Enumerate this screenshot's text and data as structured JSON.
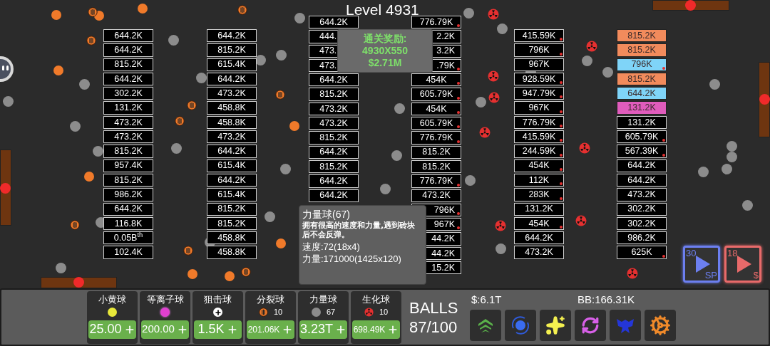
{
  "level_title": "Level 4931",
  "reward_popup": {
    "title": "通关奖励:",
    "multiplier": "4930X550",
    "money": "$2.71M"
  },
  "brick_columns": [
    {
      "bricks": [
        {
          "value": "644.2K",
          "infected": false
        },
        {
          "value": "644.2K",
          "infected": false
        },
        {
          "value": "815.2K",
          "infected": false
        },
        {
          "value": "644.2K",
          "infected": false
        },
        {
          "value": "302.2K",
          "infected": false
        },
        {
          "value": "131.2K",
          "infected": false
        },
        {
          "value": "473.2K",
          "infected": false
        },
        {
          "value": "473.2K",
          "infected": false
        },
        {
          "value": "815.2K",
          "infected": false
        },
        {
          "value": "957.4K",
          "infected": false
        },
        {
          "value": "815.2K",
          "infected": false
        },
        {
          "value": "986.2K",
          "infected": false
        },
        {
          "value": "644.2K",
          "infected": false
        },
        {
          "value": "116.8K",
          "infected": false
        },
        {
          "value": "0.05B$^{th}$",
          "infected": false
        },
        {
          "value": "102.4K",
          "infected": false
        }
      ]
    },
    {
      "bricks": [
        {
          "value": "644.2K",
          "infected": false
        },
        {
          "value": "815.2K",
          "infected": false
        },
        {
          "value": "615.4K",
          "infected": false
        },
        {
          "value": "644.2K",
          "infected": false
        },
        {
          "value": "473.2K",
          "infected": false
        },
        {
          "value": "458.8K",
          "infected": false
        },
        {
          "value": "458.8K",
          "infected": false
        },
        {
          "value": "473.2K",
          "infected": false
        },
        {
          "value": "644.2K",
          "infected": false
        },
        {
          "value": "615.4K",
          "infected": false
        },
        {
          "value": "644.2K",
          "infected": false
        },
        {
          "value": "615.4K",
          "infected": false
        },
        {
          "value": "815.2K",
          "infected": false
        },
        {
          "value": "815.2K",
          "infected": false
        },
        {
          "value": "458.8K",
          "infected": false
        },
        {
          "value": "458.8K",
          "infected": false
        }
      ]
    },
    {
      "bricks": [
        {
          "value": "644.2K",
          "infected": false
        },
        {
          "value": "444.",
          "infected": false,
          "kind": "cut_right"
        },
        {
          "value": "473.",
          "infected": false,
          "kind": "cut_right"
        },
        {
          "value": "473.",
          "infected": false,
          "kind": "cut_right"
        },
        {
          "value": "644.2K",
          "infected": false
        },
        {
          "value": "815.2K",
          "infected": false
        },
        {
          "value": "473.2K",
          "infected": false
        },
        {
          "value": "473.2K",
          "infected": false
        },
        {
          "value": "815.2K",
          "infected": false
        },
        {
          "value": "644.2K",
          "infected": false
        },
        {
          "value": "815.2K",
          "infected": false
        },
        {
          "value": "644.2K",
          "infected": false
        },
        {
          "value": "644.2K",
          "infected": false
        }
      ]
    },
    {
      "bricks": [
        {
          "value": "776.79K",
          "infected": true
        },
        {
          "value": "2.2K",
          "infected": false,
          "kind": "cut_left"
        },
        {
          "value": "3.2K",
          "infected": false,
          "kind": "cut_left"
        },
        {
          "value": ".79K",
          "infected": true,
          "kind": "cut_left"
        },
        {
          "value": "454K",
          "infected": true
        },
        {
          "value": "605.79K",
          "infected": true
        },
        {
          "value": "454K",
          "infected": true
        },
        {
          "value": "605.79K",
          "infected": true
        },
        {
          "value": "776.79K",
          "infected": true
        },
        {
          "value": "815.2K",
          "infected": false
        },
        {
          "value": "815.2K",
          "infected": false
        },
        {
          "value": "776.79K",
          "infected": true
        },
        {
          "value": "473.2K",
          "infected": false
        },
        {
          "value": "796K",
          "infected": true,
          "kind": "cut_left"
        },
        {
          "value": "967K",
          "infected": true,
          "kind": "cut_left"
        },
        {
          "value": "44.2K",
          "infected": false,
          "kind": "cut_left"
        },
        {
          "value": "44.2K",
          "infected": false,
          "kind": "cut_left"
        },
        {
          "value": "15.2K",
          "infected": false,
          "kind": "cut_left"
        }
      ]
    },
    {
      "bricks": [
        {
          "value": "415.59K",
          "infected": true
        },
        {
          "value": "796K",
          "infected": true
        },
        {
          "value": "967K",
          "infected": false
        },
        {
          "value": "928.59K",
          "infected": true
        },
        {
          "value": "947.79K",
          "infected": true
        },
        {
          "value": "967K",
          "infected": true
        },
        {
          "value": "776.79K",
          "infected": true
        },
        {
          "value": "415.59K",
          "infected": true
        },
        {
          "value": "244.59K",
          "infected": true
        },
        {
          "value": "454K",
          "infected": true
        },
        {
          "value": "112K",
          "infected": true
        },
        {
          "value": "283K",
          "infected": true
        },
        {
          "value": "131.2K",
          "infected": false
        },
        {
          "value": "454K",
          "infected": true
        },
        {
          "value": "644.2K",
          "infected": false
        },
        {
          "value": "473.2K",
          "infected": false
        }
      ]
    },
    {
      "bricks": [
        {
          "value": "815.2K",
          "infected": false,
          "color": "#f28b5c"
        },
        {
          "value": "815.2K",
          "infected": false,
          "color": "#f28b5c"
        },
        {
          "value": "796K",
          "infected": true,
          "color": "#7fd4f8"
        },
        {
          "value": "815.2K",
          "infected": false,
          "color": "#f28b5c"
        },
        {
          "value": "644.2K",
          "infected": false,
          "color": "#7fd4f8"
        },
        {
          "value": "131.2K",
          "infected": false,
          "color": "#e05cbc"
        },
        {
          "value": "131.2K",
          "infected": false
        },
        {
          "value": "605.79K",
          "infected": true
        },
        {
          "value": "567.39K",
          "infected": true
        },
        {
          "value": "644.2K",
          "infected": false
        },
        {
          "value": "644.2K",
          "infected": false
        },
        {
          "value": "473.2K",
          "infected": false
        },
        {
          "value": "302.2K",
          "infected": false
        },
        {
          "value": "302.2K",
          "infected": false
        },
        {
          "value": "986.2K",
          "infected": false
        },
        {
          "value": "625K",
          "infected": true
        }
      ]
    }
  ],
  "speed_buttons": [
    {
      "kind": "speed",
      "count": "30",
      "unit": "SP"
    },
    {
      "kind": "money",
      "count": "18",
      "unit": "$"
    }
  ],
  "tooltip": {
    "title": "力量球(67)",
    "description": "拥有很高的速度和力量,遇到砖块后不会反弹。",
    "speed": "速度:72(18x4)",
    "power": "力量:171000(1425x120)"
  },
  "ball_shop": [
    {
      "kind": "yellow",
      "name": "小黄球",
      "price": "25.00"
    },
    {
      "kind": "plasma",
      "name": "等离子球",
      "price": "200.00"
    },
    {
      "kind": "sniper",
      "name": "狙击球",
      "price": "1.5K"
    },
    {
      "kind": "split",
      "name": "分裂球",
      "count": "10",
      "price": "201.06K"
    },
    {
      "kind": "power",
      "name": "力量球",
      "count": "67",
      "price": "3.23T"
    },
    {
      "kind": "bio",
      "name": "生化球",
      "count": "10",
      "price": "698.49K"
    }
  ],
  "balls": {
    "label": "BALLS",
    "count": "87/100"
  },
  "money": "$:6.1T",
  "bb": "BB:166.31K"
}
